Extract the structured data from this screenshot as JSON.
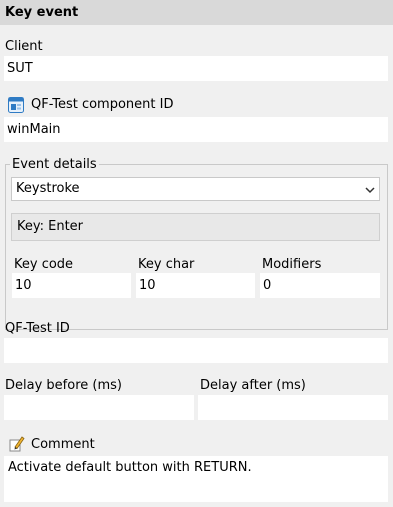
{
  "header": {
    "title": "Key event"
  },
  "client": {
    "label": "Client",
    "value": "SUT"
  },
  "component": {
    "label": "QF-Test component ID",
    "value": "winMain",
    "icon": "component-icon"
  },
  "event_details": {
    "legend": "Event details",
    "event_type": "Keystroke",
    "key_display": "Key: Enter",
    "key_code": {
      "label": "Key code",
      "value": "10"
    },
    "key_char": {
      "label": "Key char",
      "value": "10"
    },
    "modifiers": {
      "label": "Modifiers",
      "value": "0"
    }
  },
  "qftest_id": {
    "label": "QF-Test ID",
    "value": ""
  },
  "delay_before": {
    "label": "Delay before (ms)",
    "value": ""
  },
  "delay_after": {
    "label": "Delay after (ms)",
    "value": ""
  },
  "comment": {
    "label": "Comment",
    "value": "Activate default button with RETURN.",
    "icon": "pencil-icon"
  }
}
